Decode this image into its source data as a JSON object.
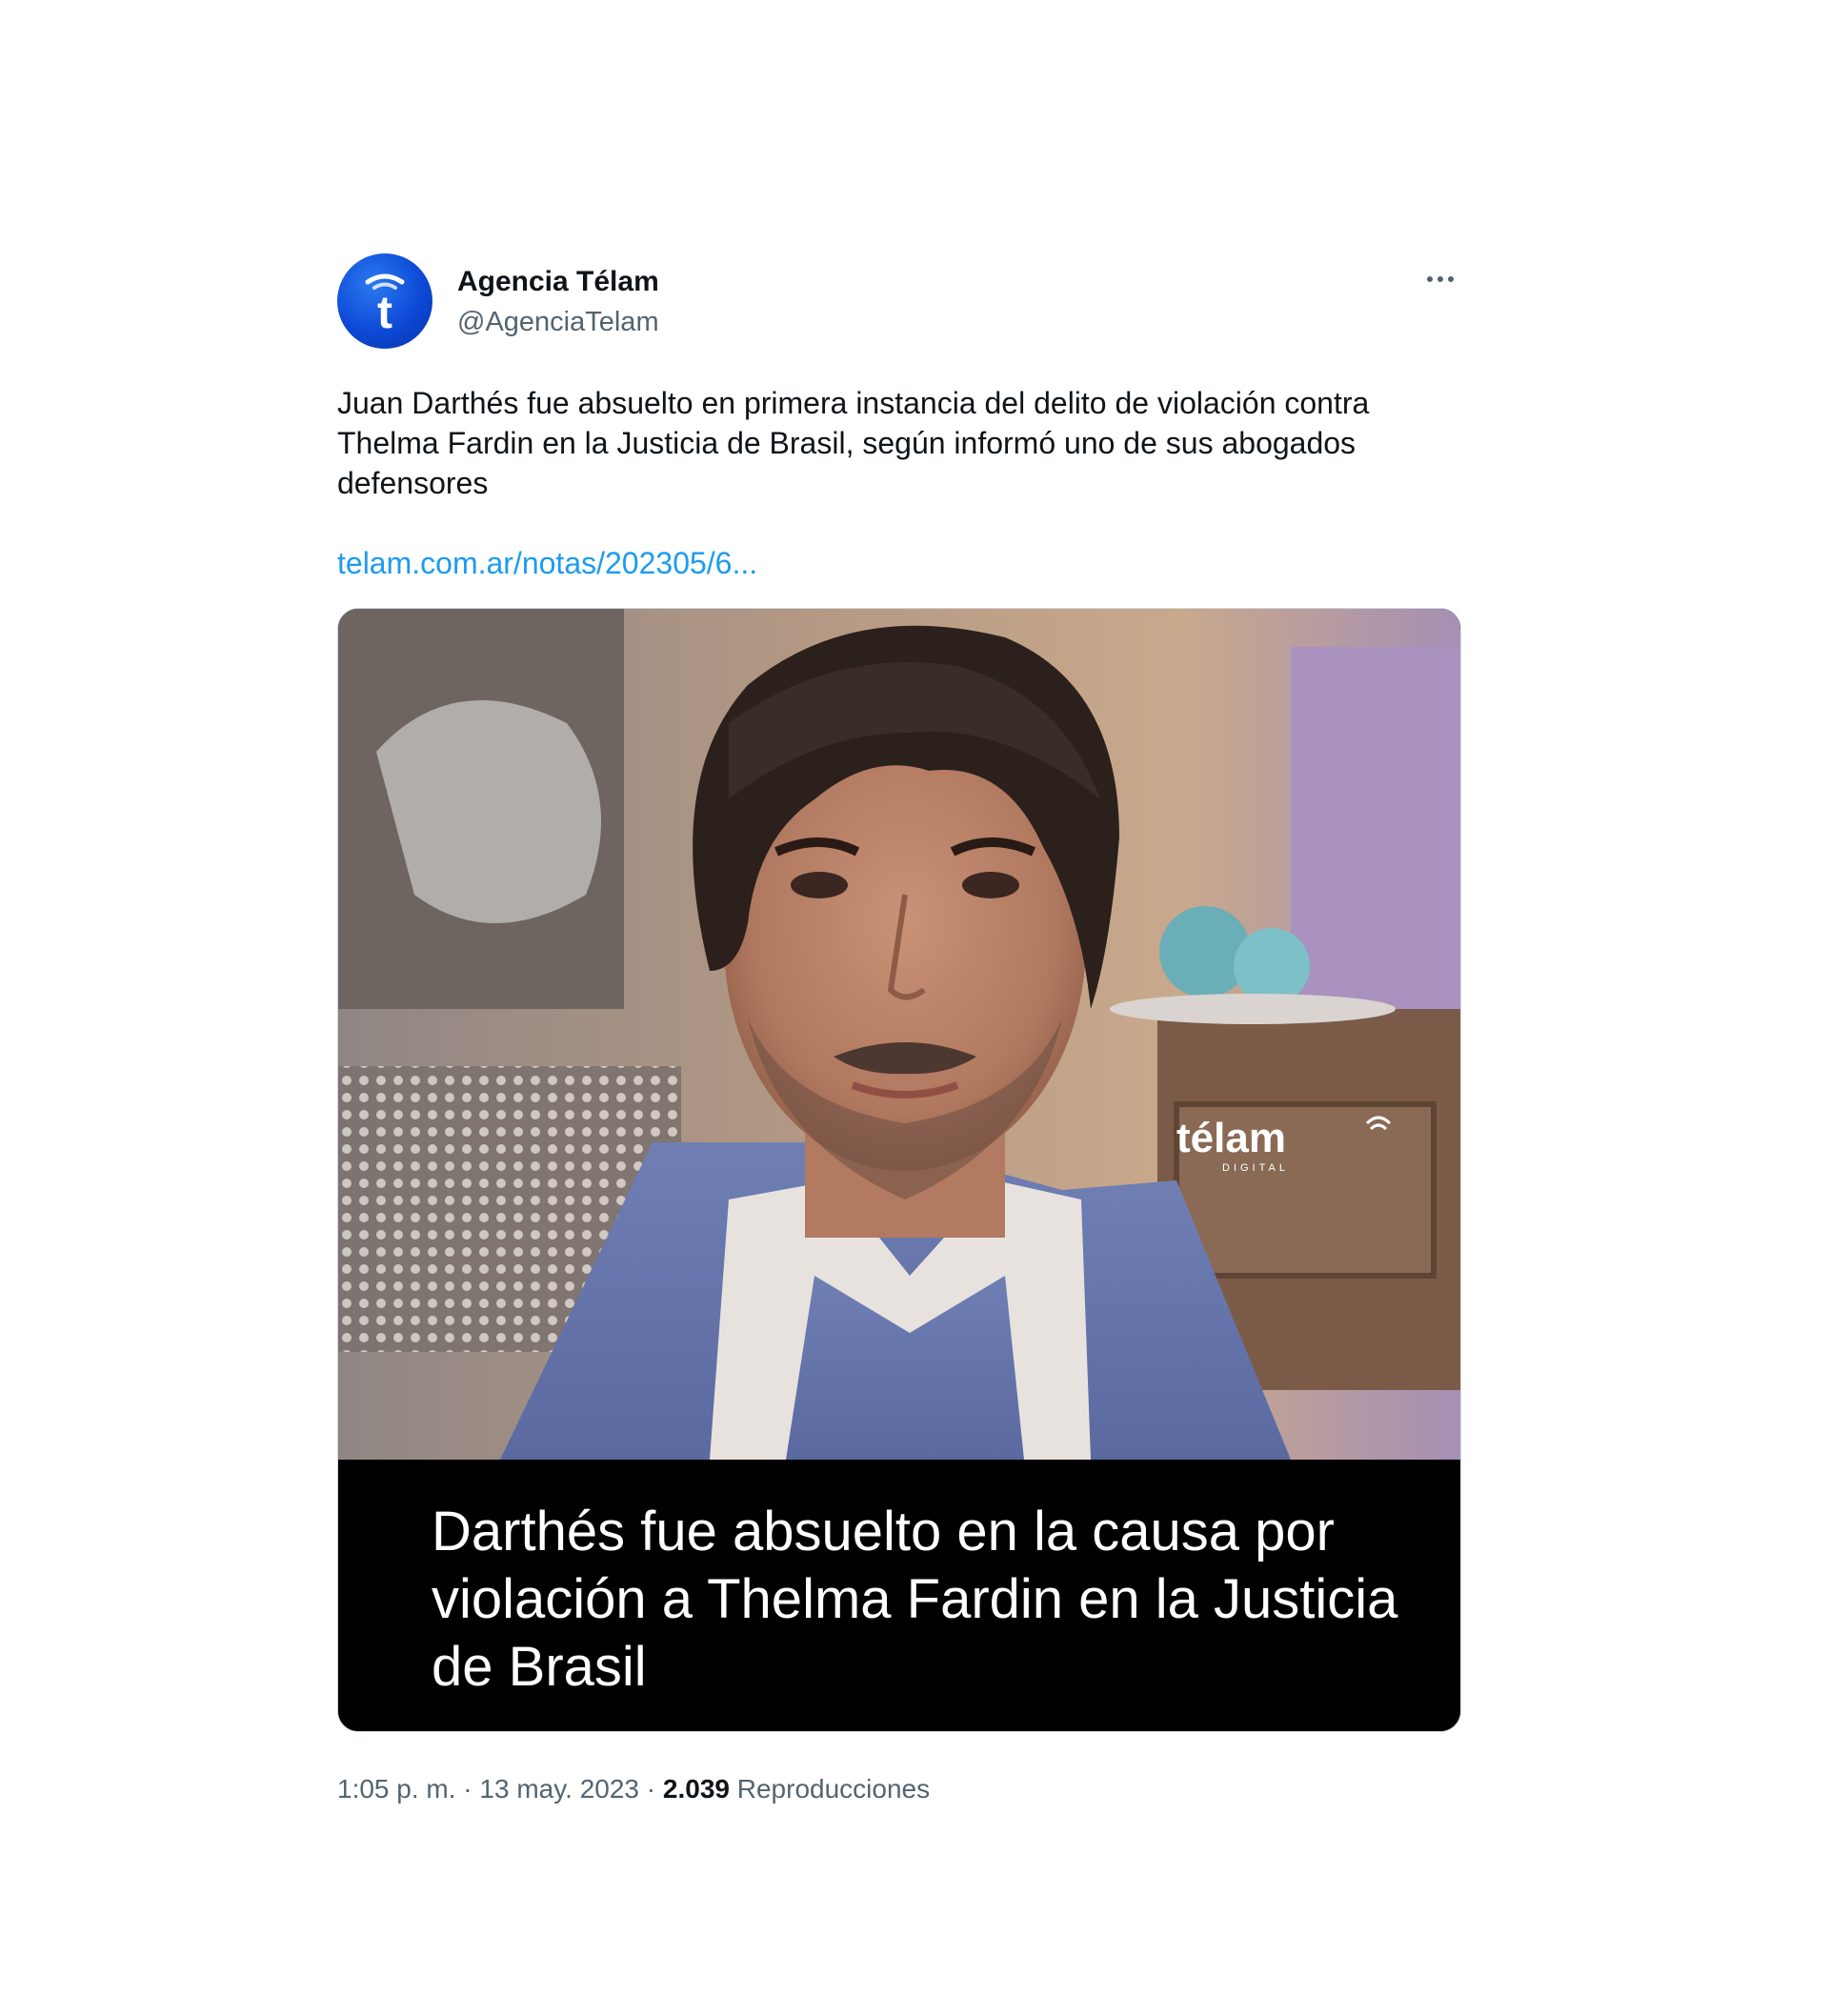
{
  "account": {
    "display_name": "Agencia Télam",
    "handle": "@AgenciaTelam",
    "avatar_letter": "t"
  },
  "tweet": {
    "text": "Juan Darthés fue absuelto en primera instancia del delito de violación contra Thelma Fardin en la Justicia de Brasil, según informó uno de sus abogados defensores",
    "link": "telam.com.ar/notas/202305/6..."
  },
  "media": {
    "watermark": "télam",
    "watermark_sub": "DIGITAL",
    "caption": "Darthés fue absuelto en la causa por violación a Thelma Fardin en la Justicia de Brasil"
  },
  "meta": {
    "time": "1:05 p. m.",
    "separator": " · ",
    "date": "13 may. 2023",
    "views_count": "2.039",
    "views_label": "Reproducciones"
  },
  "colors": {
    "link": "#1d9bf0",
    "muted": "#536471",
    "avatar": "#0d49d6"
  }
}
